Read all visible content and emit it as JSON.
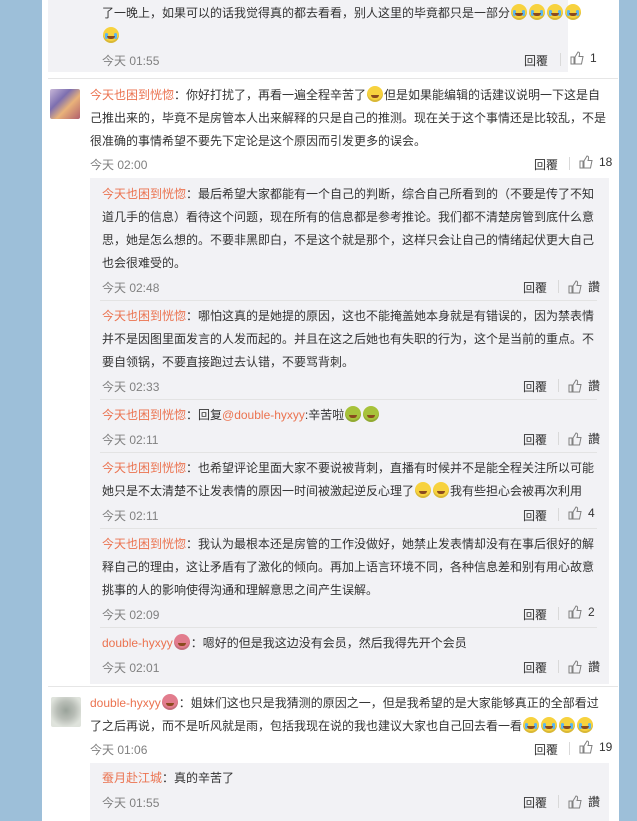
{
  "comments": {
    "c0": {
      "text_line1": "了一晚上，如果可以的话我觉得真的都去看看，别人这里的毕竟都只是一部分",
      "time": "今天 01:55",
      "reply_label": "回覆",
      "likes": "1"
    },
    "c1": {
      "author": "今天也困到恍惚",
      "text_line1": "：你好打扰了，再看一遍全程辛苦了",
      "text_line1b": "但是如果能编辑的话建议说明一下这是自",
      "text_line2": "己推出来的，毕竟不是房管本人出来解释的只是自己的推测。现在关于这个事情还是比较乱，不是",
      "text_line3": "很准确的事情希望不要先下定论是这个原因而引发更多的误会。",
      "time": "今天 02:00",
      "reply_label": "回覆",
      "likes": "18"
    },
    "r1": {
      "author": "今天也困到恍惚",
      "text_line1": "：最后希望大家都能有一个自己的判断，综合自己所看到的（不要是传了不知",
      "text_line2": "道几手的信息）看待这个问题，现在所有的信息都是参考推论。我们都不清楚房管到底什么意",
      "text_line3": "思，她是怎么想的。不要非黑即白，不是这个就是那个，这样只会让自己的情绪起伏更大自己",
      "text_line4": "也会很难受的。",
      "time": "今天 02:48",
      "reply_label": "回覆",
      "likes": "讚"
    },
    "r2": {
      "author": "今天也困到恍惚",
      "text_line1": "：哪怕这真的是她提的原因，这也不能掩盖她本身就是有错误的，因为禁表情",
      "text_line2": "并不是因图里面发言的人发而起的。并且在这之后她也有失职的行为，这个是当前的重点。不",
      "text_line3": "要自领锅，不要直接跑过去认错，不要骂背刺。",
      "time": "今天 02:33",
      "reply_label": "回覆",
      "likes": "讚"
    },
    "r3": {
      "author": "今天也困到恍惚",
      "text_prefix": "：回复",
      "mention": "@double-hyxyy",
      "text_suffix": ":辛苦啦",
      "time": "今天 02:11",
      "reply_label": "回覆",
      "likes": "讚"
    },
    "r4": {
      "author": "今天也困到恍惚",
      "text_line1": "：也希望评论里面大家不要说被背刺，直播有时候并不是能全程关注所以可能",
      "text_line2": "她只是不太清楚不让发表情的原因一时间被激起逆反心理了",
      "text_line2b": "我有些担心会被再次利用",
      "time": "今天 02:11",
      "reply_label": "回覆",
      "likes": "4"
    },
    "r5": {
      "author": "今天也困到恍惚",
      "text_line1": "：我认为最根本还是房管的工作没做好，她禁止发表情却没有在事后很好的解",
      "text_line2": "释自己的理由，这让矛盾有了激化的倾向。再加上语言环境不同，各种信息差和别有用心故意",
      "text_line3": "挑事的人的影响使得沟通和理解意思之间产生误解。",
      "time": "今天 02:09",
      "reply_label": "回覆",
      "likes": "2"
    },
    "r6": {
      "author": "double-hyxyy",
      "text_line1": "：嗯好的但是我这边没有会员，然后我得先开个会员",
      "time": "今天 02:01",
      "reply_label": "回覆",
      "likes": "讚"
    },
    "c2": {
      "author": "double-hyxyy",
      "text_line1": "：姐妹们这也只是我猜测的原因之一，但是我希望的是大家能够真正的全部看过",
      "text_line2": "了之后再说，而不是听风就是雨，包括我现在说的我也建议大家也自己回去看一看",
      "time": "今天 01:06",
      "reply_label": "回覆",
      "likes": "19"
    },
    "r7": {
      "author": "蚕月赴江城",
      "text_line1": "：真的辛苦了",
      "time": "今天 01:55",
      "reply_label": "回覆",
      "likes": "讚"
    }
  }
}
